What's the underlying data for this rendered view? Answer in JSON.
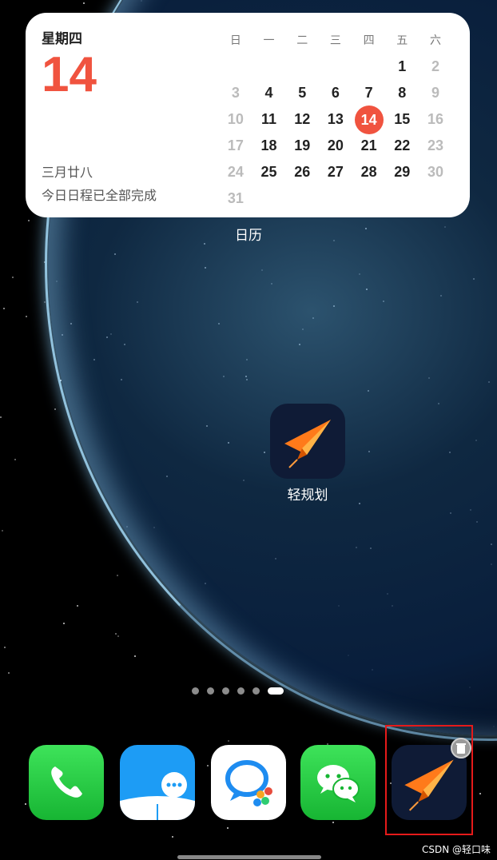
{
  "calendar_widget": {
    "weekday": "星期四",
    "day": "14",
    "lunar": "三月廿八",
    "schedule": "今日日程已全部完成",
    "headers": [
      "日",
      "一",
      "二",
      "三",
      "四",
      "五",
      "六"
    ],
    "rows": [
      [
        "",
        "",
        "",
        "",
        "",
        "1",
        "2"
      ],
      [
        "3",
        "4",
        "5",
        "6",
        "7",
        "8",
        "9"
      ],
      [
        "10",
        "11",
        "12",
        "13",
        "14",
        "15",
        "16"
      ],
      [
        "17",
        "18",
        "19",
        "20",
        "21",
        "22",
        "23"
      ],
      [
        "24",
        "25",
        "26",
        "27",
        "28",
        "29",
        "30"
      ],
      [
        "31",
        "",
        "",
        "",
        "",
        "",
        ""
      ]
    ],
    "today": "14",
    "label": "日历"
  },
  "apps": {
    "qingguihua_label": "轻规划"
  },
  "page_dots": {
    "count": 6,
    "active": 6
  },
  "dock": [
    {
      "name": "phone-app",
      "icon": "phone-icon",
      "color": "#22c53e"
    },
    {
      "name": "bookshelf-app",
      "icon": "chat-book-icon",
      "color": "#1d9cf5"
    },
    {
      "name": "enterprise-chat-app",
      "icon": "chat-bubble-icon",
      "color": "#ffffff"
    },
    {
      "name": "wechat-app",
      "icon": "wechat-icon",
      "color": "#22c53e"
    },
    {
      "name": "qingguihua-app",
      "icon": "paper-plane-icon",
      "color": "#0f1b36"
    }
  ],
  "watermark": "CSDN @轻口味",
  "colors": {
    "accent_red": "#f0533f",
    "highlight_border": "#e51a1a"
  }
}
